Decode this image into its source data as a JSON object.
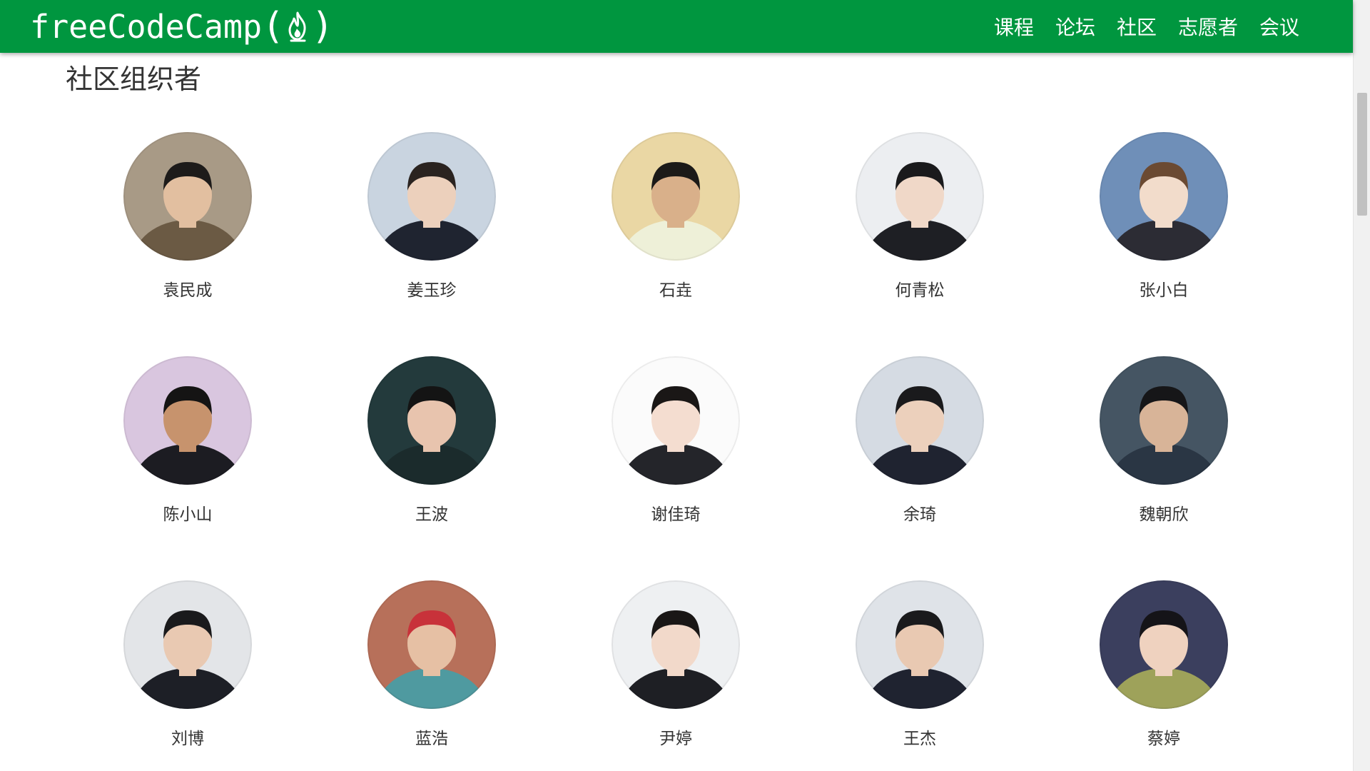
{
  "navbar": {
    "brand_text": "freeCodeCamp",
    "brand_paren_open": "(",
    "brand_paren_close": ")",
    "brand_icon": "flame-icon",
    "links": [
      "课程",
      "论坛",
      "社区",
      "志愿者",
      "会议"
    ],
    "background_color": "#00963f"
  },
  "main": {
    "section_title": "社区组织者",
    "organizers": [
      {
        "name": "袁民成",
        "bg": "#a89a86",
        "clothes": "#6b5a44",
        "skin": "#e2bfa0",
        "hair": "#1d1b1a"
      },
      {
        "name": "姜玉珍",
        "bg": "#c9d4e0",
        "clothes": "#1f2430",
        "skin": "#ecd0bc",
        "hair": "#2a2320"
      },
      {
        "name": "石垚",
        "bg": "#ead7a4",
        "clothes": "#eef0d8",
        "skin": "#d9b08a",
        "hair": "#1c1a18"
      },
      {
        "name": "何青松",
        "bg": "#eceef1",
        "clothes": "#1e1f24",
        "skin": "#f0d8c8",
        "hair": "#1a1a1c"
      },
      {
        "name": "张小白",
        "bg": "#6f8fb8",
        "clothes": "#2c2c34",
        "skin": "#f2dccb",
        "hair": "#6b4a32"
      },
      {
        "name": "陈小山",
        "bg": "#d9c6df",
        "clothes": "#1c1c22",
        "skin": "#c7936d",
        "hair": "#151414"
      },
      {
        "name": "王波",
        "bg": "#233a3c",
        "clothes": "#1b2b2c",
        "skin": "#e8c4ae",
        "hair": "#141414"
      },
      {
        "name": "谢佳琦",
        "bg": "#fbfbfb",
        "clothes": "#24252a",
        "skin": "#f4ddd0",
        "hair": "#1a1716"
      },
      {
        "name": "余琦",
        "bg": "#d5dbe3",
        "clothes": "#1f2330",
        "skin": "#ecd0bc",
        "hair": "#1a1a1c"
      },
      {
        "name": "魏朝欣",
        "bg": "#455563",
        "clothes": "#2a3644",
        "skin": "#d8b498",
        "hair": "#161618"
      },
      {
        "name": "刘博",
        "bg": "#e3e5e8",
        "clothes": "#1d1f26",
        "skin": "#e9c9b2",
        "hair": "#1a1a1c"
      },
      {
        "name": "蓝浩",
        "bg": "#b7705a",
        "clothes": "#4f9aa0",
        "skin": "#e6c0a4",
        "hair": "#c8323a"
      },
      {
        "name": "尹婷",
        "bg": "#eef0f2",
        "clothes": "#1e1f24",
        "skin": "#f2d9ca",
        "hair": "#1a1716"
      },
      {
        "name": "王杰",
        "bg": "#dfe3e8",
        "clothes": "#1f2330",
        "skin": "#e9c9b2",
        "hair": "#1a1a1c"
      },
      {
        "name": "蔡婷",
        "bg": "#3b3f5e",
        "clothes": "#9ea25a",
        "skin": "#efd2bf",
        "hair": "#151418"
      }
    ]
  }
}
